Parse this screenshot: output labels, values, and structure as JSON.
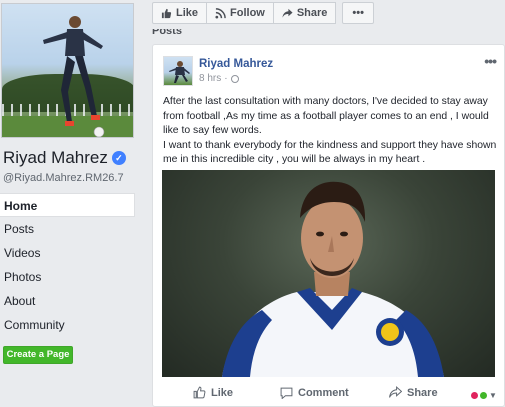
{
  "profile": {
    "name": "Riyad Mahrez",
    "verified_mark": "✓",
    "username": "@Riyad.Mahrez.RM26.7"
  },
  "nav": {
    "items": [
      {
        "label": "Home",
        "active": true
      },
      {
        "label": "Posts"
      },
      {
        "label": "Videos"
      },
      {
        "label": "Photos"
      },
      {
        "label": "About"
      },
      {
        "label": "Community"
      }
    ]
  },
  "create_page_label": "Create a Page",
  "action_bar": {
    "like_label": "Like",
    "follow_label": "Follow",
    "share_label": "Share",
    "more_label": "•••"
  },
  "posts_label": "Posts",
  "post": {
    "author": "Riyad Mahrez",
    "time": "8 hrs",
    "options_label": "•••",
    "text_lines": [
      "After the last consultation with many doctors, I've decided to stay away",
      "from football ,As my time as a football player comes to an end , I would",
      "like to say few words.",
      "I want to thank everybody for the kindness and support they have shown",
      "me in this incredible city , you will be always in my heart ."
    ],
    "footer": {
      "like_label": "Like",
      "comment_label": "Comment",
      "share_label": "Share"
    }
  },
  "colors": {
    "link_blue": "#365899",
    "verified_blue": "#4080ff",
    "create_green": "#42b72a",
    "jersey_blue": "#1d3f8f",
    "reaction_red": "#e0245e",
    "reaction_green": "#42b72a"
  },
  "icons": {
    "like": "thumbs-up-icon",
    "follow": "rss-icon",
    "share": "share-arrow-icon",
    "comment": "speech-bubble-icon",
    "privacy": "globe-icon"
  }
}
